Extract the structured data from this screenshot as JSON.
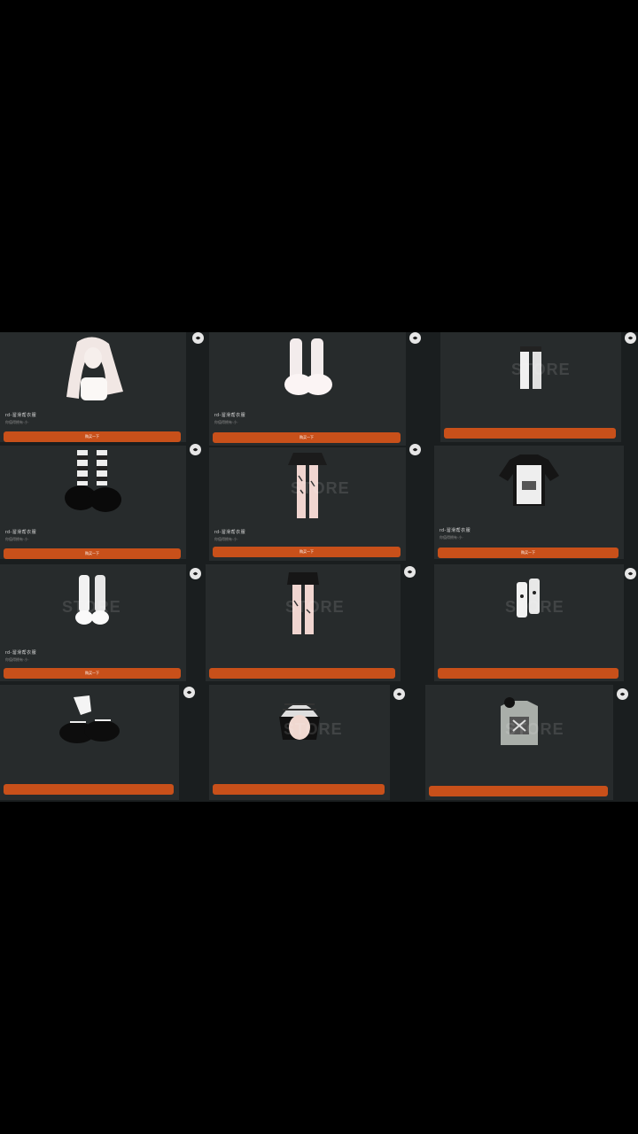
{
  "products": [
    {
      "title": "rd-溜滑帮衣服",
      "subtitle": "你值得拥有·小·",
      "button": "购买一下",
      "item": "hair-icon"
    },
    {
      "title": "rd-溜滑帮衣服",
      "subtitle": "你值得拥有·小·",
      "button": "购买一下",
      "item": "fluffy-leg-warmers-icon"
    },
    {
      "title": "",
      "subtitle": "",
      "button": "",
      "item": "leg-warmers-icon"
    },
    {
      "title": "rd-溜滑帮衣服",
      "subtitle": "你值得拥有·小·",
      "button": "购买一下",
      "item": "platform-shoes-icon"
    },
    {
      "title": "rd-溜滑帮衣服",
      "subtitle": "你值得拥有·小·",
      "button": "购买一下",
      "item": "skirt-tights-icon"
    },
    {
      "title": "rd-溜滑帮衣服",
      "subtitle": "你值得拥有·小·",
      "button": "购买一下",
      "item": "shirt-icon"
    },
    {
      "title": "rd-溜滑帮衣服",
      "subtitle": "你值得拥有·小·",
      "button": "购买一下",
      "item": "boots-icon"
    },
    {
      "title": "",
      "subtitle": "",
      "button": "",
      "item": "shorts-tights-icon"
    },
    {
      "title": "",
      "subtitle": "",
      "button": "",
      "item": "leg-warmers-icon"
    },
    {
      "title": "",
      "subtitle": "",
      "button": "",
      "item": "platform-shoes-icon"
    },
    {
      "title": "",
      "subtitle": "",
      "button": "",
      "item": "beanie-hair-icon"
    },
    {
      "title": "",
      "subtitle": "",
      "button": "",
      "item": "graphic-top-icon"
    }
  ],
  "watermark": "STORE",
  "colors": {
    "button": "#c8501a",
    "card": "#272b2c",
    "background": "#000000"
  }
}
